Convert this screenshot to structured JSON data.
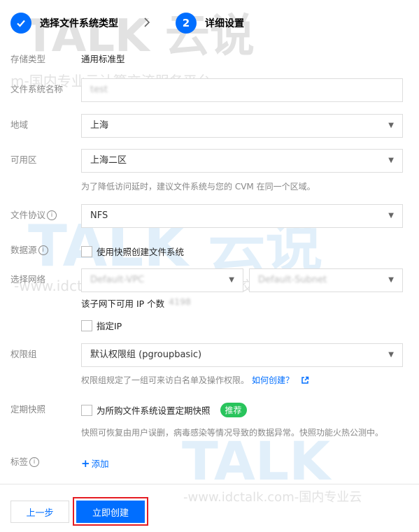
{
  "steps": [
    {
      "number": "",
      "label": "选择文件系统类型"
    },
    {
      "number": "2",
      "label": "详细设置"
    }
  ],
  "form": {
    "storage_type": {
      "label": "存储类型",
      "value": "通用标准型"
    },
    "fs_name": {
      "label": "文件系统名称",
      "value": "test"
    },
    "region": {
      "label": "地域",
      "value": "上海"
    },
    "zone": {
      "label": "可用区",
      "value": "上海二区",
      "hint": "为了降低访问延时，建议文件系统与您的 CVM 在同一个区域。"
    },
    "protocol": {
      "label": "文件协议",
      "value": "NFS"
    },
    "datasource": {
      "label": "数据源",
      "checkbox_label": "使用快照创建文件系统"
    },
    "network": {
      "label": "选择网络",
      "vpc_value": "Default-VPC",
      "subnet_value": "Default-Subnet",
      "ip_available_label": "该子网下可用 IP 个数",
      "ip_available_count": "4198",
      "specify_ip_label": "指定IP"
    },
    "permission_group": {
      "label": "权限组",
      "value": "默认权限组 (pgroupbasic)",
      "hint": "权限组规定了一组可来访白名单及操作权限。",
      "link": "如何创建？"
    },
    "snapshot": {
      "label": "定期快照",
      "checkbox_label": "为所购文件系统设置定期快照",
      "badge": "推荐",
      "hint": "快照可恢复由用户误删，病毒感染等情况导致的数据异常。快照功能火热公测中。"
    },
    "tags": {
      "label": "标签",
      "add_label": "添加"
    }
  },
  "buttons": {
    "prev": "上一步",
    "create": "立即创建"
  },
  "watermarks": {
    "logo_top": "TALK 云说",
    "line_top": "m-国内专业云计算交流服务平台-",
    "logo_mid": "TALK 云说",
    "line_mid": "-www.idctalk.com-国内专业云计算交流服务平台-",
    "logo_bottom": "TALK",
    "line_bottom": "-www.idctalk.com-国内专业云"
  },
  "icons": {
    "check": "check-icon",
    "step_arrow": "chevron-right-icon",
    "caret": "caret-down-icon",
    "info": "info-icon",
    "plus": "plus-icon",
    "external": "external-link-icon"
  },
  "colors": {
    "primary": "#006eff",
    "success": "#29c45c",
    "highlight": "#e51c23"
  }
}
